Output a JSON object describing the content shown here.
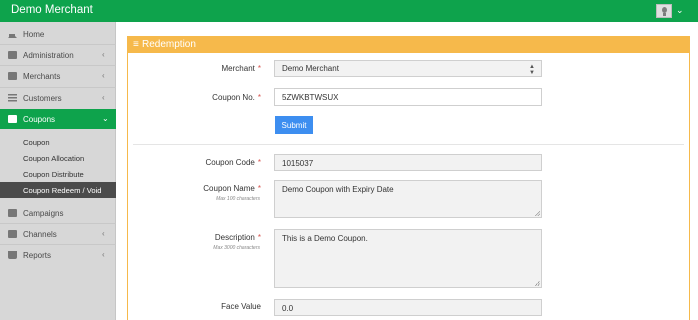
{
  "topbar": {
    "brand": "Demo Merchant"
  },
  "sidebar": {
    "items": [
      {
        "label": "Home",
        "icon": "home-icon"
      },
      {
        "label": "Administration",
        "icon": "users-icon"
      },
      {
        "label": "Merchants",
        "icon": "briefcase-icon"
      },
      {
        "label": "Customers",
        "icon": "list-icon"
      },
      {
        "label": "Coupons",
        "icon": "users-icon"
      },
      {
        "label": "Campaigns",
        "icon": "user-icon"
      },
      {
        "label": "Channels",
        "icon": "users-icon"
      },
      {
        "label": "Reports",
        "icon": "cart-icon"
      }
    ],
    "submenu": [
      {
        "label": "Coupon"
      },
      {
        "label": "Coupon Allocation"
      },
      {
        "label": "Coupon Distribute"
      },
      {
        "label": "Coupon Redeem / Void"
      }
    ]
  },
  "panel": {
    "title": "Redemption",
    "merchant_label": "Merchant",
    "merchant_value": "Demo Merchant",
    "coupon_no_label": "Coupon No.",
    "coupon_no_value": "5ZWKBTWSUX",
    "submit_label": "Submit",
    "coupon_code_label": "Coupon Code",
    "coupon_code_value": "1015037",
    "coupon_name_label": "Coupon Name",
    "coupon_name_hint": "Max 100 characters",
    "coupon_name_value": "Demo Coupon with Expiry Date",
    "description_label": "Description",
    "description_hint": "Max 3000 characters",
    "description_value": "This is a Demo Coupon.",
    "face_value_label": "Face Value",
    "face_value_value": "0.0",
    "required_mark": "*"
  },
  "colors": {
    "brand_green": "#0ea34c",
    "panel_orange": "#f6b94b",
    "button_blue": "#3d8ef0",
    "required_red": "#d9534f"
  }
}
